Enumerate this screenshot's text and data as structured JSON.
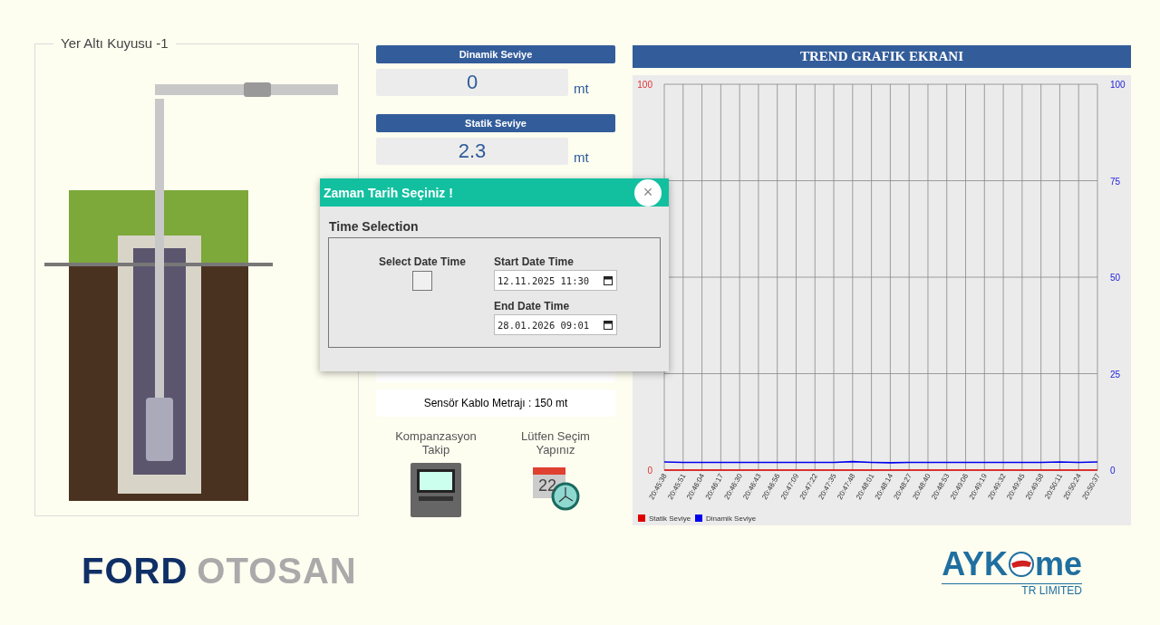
{
  "well_panel": {
    "title": "Yer Altı Kuyusu -1"
  },
  "gauges": [
    {
      "label": "Dinamik Seviye",
      "value": "0",
      "unit": "mt"
    },
    {
      "label": "Statik Seviye",
      "value": "2.3",
      "unit": "mt"
    }
  ],
  "info_rows": [
    "Sensör Kablo Metrajı : 150 mt"
  ],
  "shortcuts": [
    {
      "kind": "controller",
      "label": "Kompanzasyon Takip"
    },
    {
      "kind": "calendar",
      "label": "Lütfen Seçim Yapınız",
      "day": "22"
    }
  ],
  "trend": {
    "title": "TREND GRAFIK EKRANI",
    "chart_data": {
      "type": "line",
      "categories": [
        "20:45:38",
        "20:45:51",
        "20:46:04",
        "20:46:17",
        "20:46:30",
        "20:46:43",
        "20:46:56",
        "20:47:09",
        "20:47:22",
        "20:47:35",
        "20:47:48",
        "20:48:01",
        "20:48:14",
        "20:48:27",
        "20:48:40",
        "20:48:53",
        "20:49:06",
        "20:49:19",
        "20:49:32",
        "20:49:45",
        "20:49:58",
        "20:50:11",
        "20:50:24",
        "20:50:37"
      ],
      "series": [
        {
          "name": "Statik Seviye",
          "color": "#e00000",
          "values": [
            0,
            0,
            0,
            0,
            0,
            0,
            0,
            0,
            0,
            0,
            0,
            0,
            0,
            0,
            0,
            0,
            0,
            0,
            0,
            0,
            0,
            0,
            0,
            0
          ]
        },
        {
          "name": "Dinamik Seviye",
          "color": "#0000ee",
          "values": [
            2.1,
            2,
            2,
            2,
            2,
            2,
            2,
            2,
            2,
            2,
            2.2,
            2,
            1.9,
            2,
            2,
            2,
            2,
            2,
            2,
            2,
            2,
            2.1,
            2,
            2.1
          ]
        }
      ],
      "ylim": [
        0,
        100
      ],
      "yticks": [
        0,
        25,
        50,
        75,
        100
      ],
      "grid": true,
      "legend": "bottom-left"
    },
    "left_tick_labels": [
      "100",
      "0"
    ],
    "right_ticks": [
      "100",
      "75",
      "50",
      "25",
      "0"
    ]
  },
  "modal": {
    "title": "Zaman Tarih Seçiniz !",
    "close": "×",
    "section": "Time Selection",
    "select_label": "Select Date Time",
    "select_checked": false,
    "start_label": "Start Date Time",
    "start_value": "12.11.2025 11:30",
    "end_label": "End Date Time",
    "end_value": "28.01.2026 09:01"
  },
  "footer": {
    "left_logo": {
      "part1": "FORD",
      "part2": "OTOSAN"
    },
    "right_logo": {
      "part1": "AYK",
      "part2": "me",
      "sub": "TR LIMITED"
    }
  }
}
